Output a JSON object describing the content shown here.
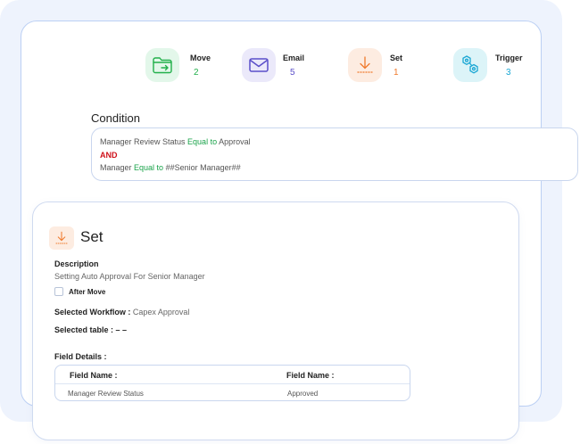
{
  "actions": [
    {
      "label": "Move",
      "count": "2",
      "icon": "folder-move-icon",
      "color": "#22b04b",
      "bg": "#e3f7ea"
    },
    {
      "label": "Email",
      "count": "5",
      "icon": "envelope-icon",
      "color": "#5b4fc9",
      "bg": "#ebe9fa"
    },
    {
      "label": "Set",
      "count": "1",
      "icon": "download-arrow-icon",
      "color": "#f07a2c",
      "bg": "#fdece1"
    },
    {
      "label": "Trigger",
      "count": "3",
      "icon": "hexagon-nodes-icon",
      "color": "#1aa7d4",
      "bg": "#dcf4f8"
    }
  ],
  "condition": {
    "title": "Condition",
    "line1": {
      "field": "Manager Review Status ",
      "operator": "Equal to",
      "value": " Approval"
    },
    "joiner": "AND",
    "line2": {
      "field": "Manager ",
      "operator": "Equal to",
      "value": " ##Senior Manager##"
    }
  },
  "set_panel": {
    "title": "Set",
    "description_label": "Description",
    "description_value": "Setting Auto Approval For Senior Manager",
    "after_move_label": "After Move",
    "after_move_checked": false,
    "workflow_label": "Selected Workflow : ",
    "workflow_value": "Capex Approval",
    "table_label": "Selected table : ",
    "table_value": "– –",
    "field_details_label": "Field Details :",
    "table_headers": [
      "Field Name :",
      "Field Name :"
    ],
    "table_rows": [
      [
        "Manager Review Status",
        "Approved"
      ]
    ]
  },
  "colors": {
    "accent_green": "#1aa34a",
    "and_red": "#d0121b",
    "border_blue": "#bcd0f4",
    "background": "#eef3fd"
  }
}
